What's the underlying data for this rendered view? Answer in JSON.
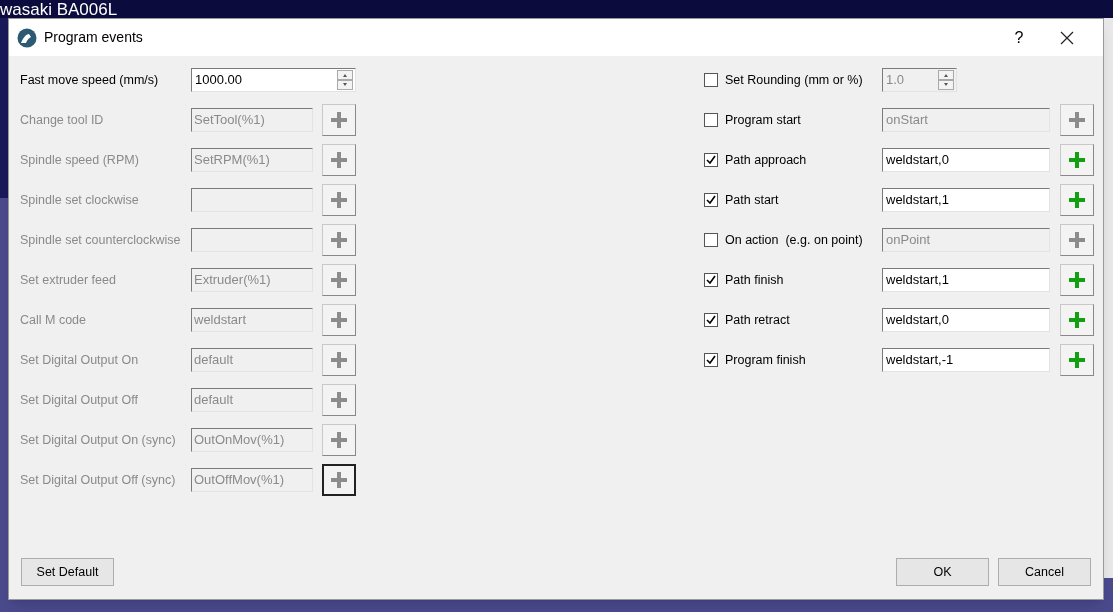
{
  "background": {
    "title": "wasaki BA006L"
  },
  "dialog": {
    "title": "Program events",
    "help": "?"
  },
  "left_rows": [
    {
      "kind": "spin",
      "label": "Fast move speed (mm/s)",
      "value": "1000.00",
      "disabled": false
    },
    {
      "kind": "code",
      "label": "Change tool ID",
      "value": "SetTool(%1)",
      "disabled": true,
      "focused": false
    },
    {
      "kind": "code",
      "label": "Spindle speed (RPM)",
      "value": "SetRPM(%1)",
      "disabled": true,
      "focused": false
    },
    {
      "kind": "code",
      "label": "Spindle set clockwise",
      "disabled": true,
      "focused": false
    },
    {
      "kind": "code",
      "label": "Spindle set counterclockwise",
      "disabled": true,
      "focused": false
    },
    {
      "kind": "code",
      "label": "Set extruder feed",
      "value": "Extruder(%1)",
      "disabled": true,
      "focused": false
    },
    {
      "kind": "code",
      "label": "Call M code",
      "value": "weldstart",
      "disabled": true,
      "focused": false
    },
    {
      "kind": "code",
      "label": "Set Digital Output On",
      "value": "default",
      "disabled": true,
      "focused": false
    },
    {
      "kind": "code",
      "label": "Set Digital Output Off",
      "value": "default",
      "disabled": true,
      "focused": false
    },
    {
      "kind": "code",
      "label": "Set Digital Output On (sync)",
      "value": "OutOnMov(%1)",
      "disabled": true,
      "focused": false
    },
    {
      "kind": "code",
      "label": "Set Digital Output Off (sync)",
      "value": "OutOffMov(%1)",
      "disabled": true,
      "focused": true
    }
  ],
  "right_rows": [
    {
      "kind": "spin",
      "label": "Set Rounding (mm or %)",
      "value": "1.0",
      "checked": false
    },
    {
      "kind": "code",
      "label": "Program start",
      "value": "onStart",
      "checked": false
    },
    {
      "kind": "code",
      "label": "Path approach",
      "value": "weldstart,0",
      "checked": true
    },
    {
      "kind": "code",
      "label": "Path start",
      "value": "weldstart,1",
      "checked": true
    },
    {
      "kind": "code",
      "label": "On action  (e.g. on point)",
      "value": "onPoint",
      "checked": false
    },
    {
      "kind": "code",
      "label": "Path finish",
      "value": "weldstart,1",
      "checked": true
    },
    {
      "kind": "code",
      "label": "Path retract",
      "value": "weldstart,0",
      "checked": true
    },
    {
      "kind": "code",
      "label": "Program finish",
      "value": "weldstart,-1",
      "checked": true
    }
  ],
  "buttons": {
    "left": "Set Default",
    "ok": "OK",
    "cancel": "Cancel"
  }
}
